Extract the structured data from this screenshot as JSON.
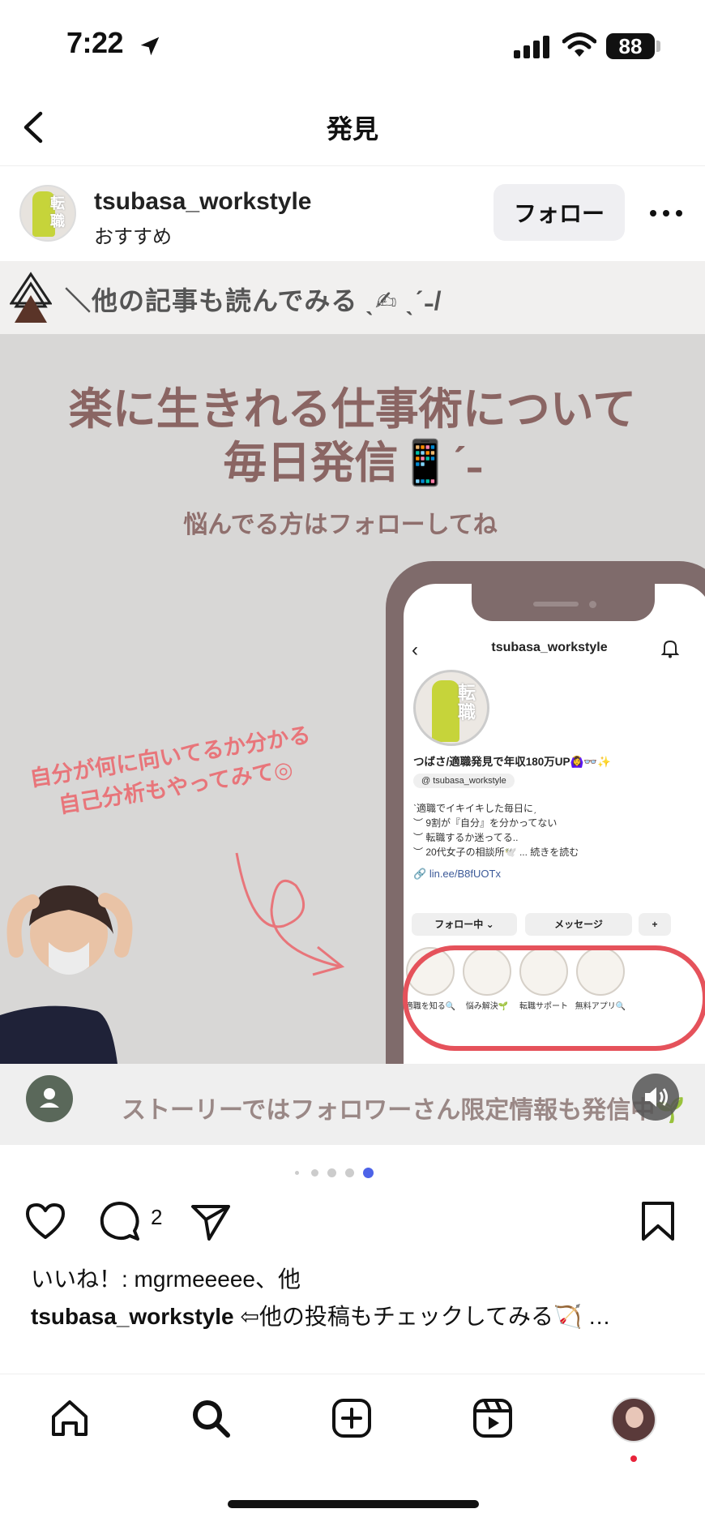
{
  "status_bar": {
    "time": "7:22",
    "battery": "88"
  },
  "header": {
    "title": "発見"
  },
  "post": {
    "username": "tsubasa_workstyle",
    "subtitle": "おすすめ",
    "follow_label": "フォロー",
    "avatar_text": "転職",
    "image": {
      "banner": "＼他の記事も読んでみる ˎ✍︎ ˎˊ˗/",
      "headline_line1": "楽に生きれる仕事術について",
      "headline_line2": "毎日発信📱ˊ˗",
      "subhead": "悩んでる方はフォローしてね",
      "side_note_line1": "自分が何に向いてるか分かる",
      "side_note_line2": "自己分析もやってみて◎",
      "story_text": "ストーリーではフォロワーさん限定情報も発信中🌱",
      "phone": {
        "username": "tsubasa_workstyle",
        "avatar_text": "転職",
        "bio_name": "つばさ/適職発見で年収180万UP🙆‍♀️👓✨",
        "threads": "tsubasa_workstyle",
        "bio_lines": [
          "ˋ適職でイキイキした毎日にˏ",
          "︶ 9割が『自分』を分かってない",
          "︶ 転職するか迷ってる..",
          "︶ 20代女子の相談所🕊️ ... 続きを読む"
        ],
        "link": "lin.ee/B8fUOTx",
        "following_label": "フォロー中",
        "message_label": "メッセージ",
        "highlights": [
          "適職を知る🔍",
          "悩み解決🌱",
          "転職サポート",
          "無料アプリ🔍"
        ]
      }
    },
    "comment_count": "2",
    "likes_text": "いいね！: mgrmeeeee、他",
    "caption_user": "tsubasa_workstyle",
    "caption_text": " ⇦他の投稿もチェックしてみる🏹 …"
  },
  "colors": {
    "accent_dot": "#4d63e8",
    "notification": "#e8233a",
    "headline": "#8a6563",
    "highlight_ring": "#e5525b"
  },
  "icons": [
    "back-icon",
    "more-icon",
    "heart-icon",
    "comment-icon",
    "share-icon",
    "bookmark-icon",
    "home-icon",
    "search-icon",
    "create-icon",
    "reels-icon",
    "profile-icon"
  ]
}
